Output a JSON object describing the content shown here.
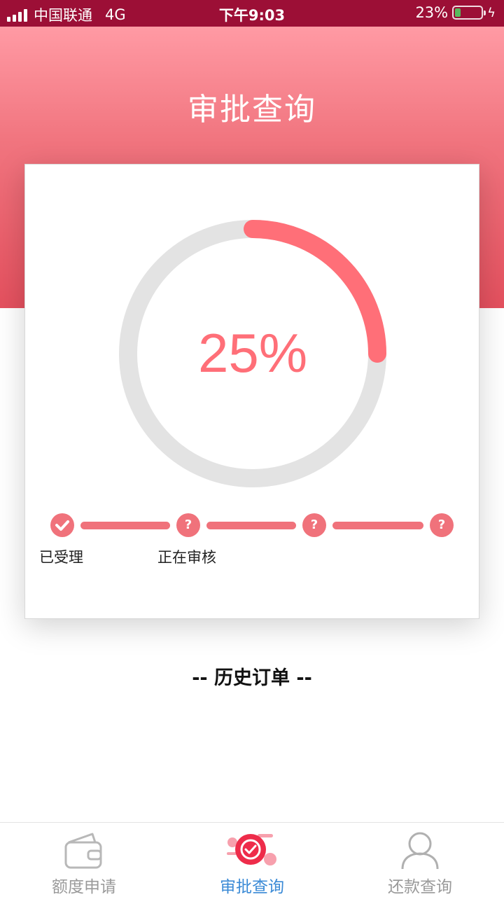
{
  "status_bar": {
    "carrier": "中国联通",
    "network": "4G",
    "time": "下午9:03",
    "battery": "23%",
    "battery_level": 0.23
  },
  "header": {
    "title": "审批查询"
  },
  "progress": {
    "percent": 25,
    "label": "25%",
    "accent": "#ff6f78",
    "track": "#e3e3e3"
  },
  "steps": [
    {
      "status": "done",
      "icon": "check-icon",
      "label": "已受理"
    },
    {
      "status": "pending",
      "icon": "question-icon",
      "label": "正在审核"
    },
    {
      "status": "pending",
      "icon": "question-icon",
      "label": ""
    },
    {
      "status": "pending",
      "icon": "question-icon",
      "label": ""
    }
  ],
  "history": {
    "title": "-- 历史订单 --"
  },
  "tabbar": {
    "items": [
      {
        "label": "额度申请",
        "icon": "wallet-icon",
        "active": false
      },
      {
        "label": "审批查询",
        "icon": "approval-check-icon",
        "active": true
      },
      {
        "label": "还款查询",
        "icon": "user-icon",
        "active": false
      }
    ],
    "active_color": "#3a8ad6",
    "inactive_color": "#9a9a9a"
  }
}
